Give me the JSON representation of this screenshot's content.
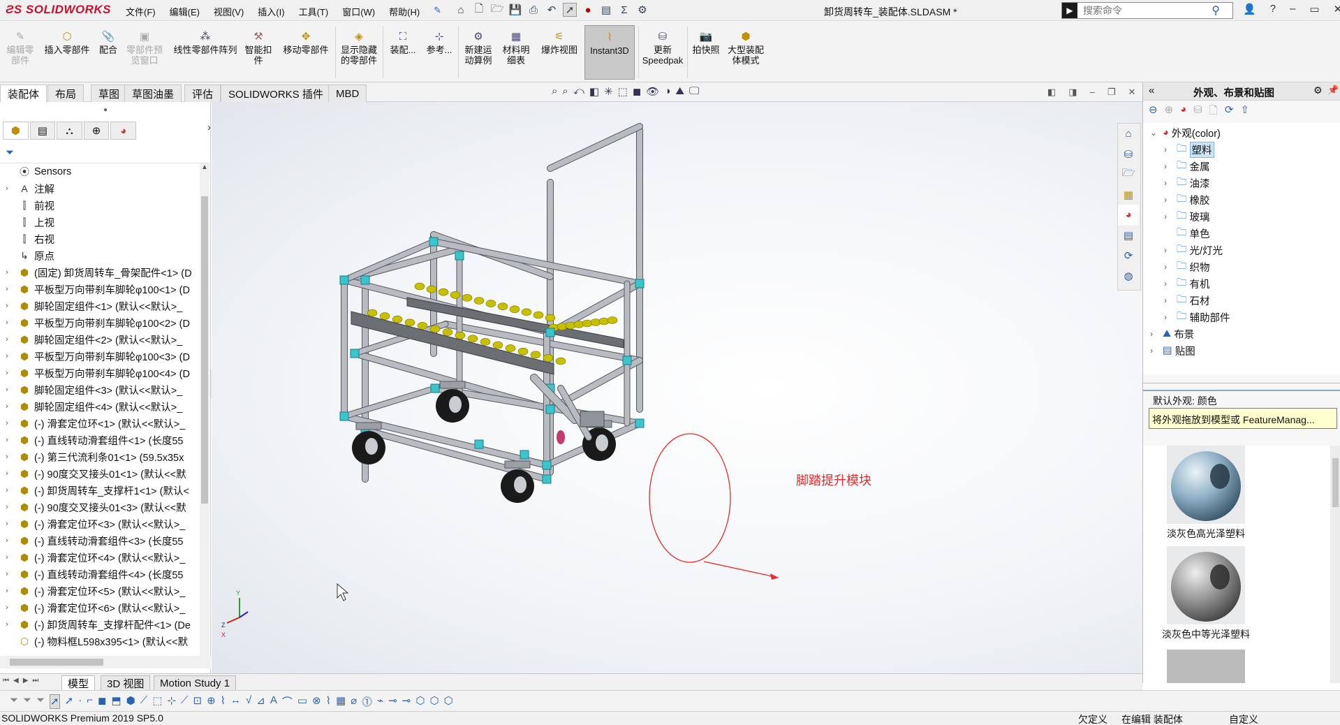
{
  "app": {
    "logo": "SOLIDWORKS",
    "doc_title": "卸货周转车_装配体.SLDASM *"
  },
  "menu": [
    "文件(F)",
    "编辑(E)",
    "视图(V)",
    "插入(I)",
    "工具(T)",
    "窗口(W)",
    "帮助(H)"
  ],
  "search": {
    "placeholder": "搜索命令"
  },
  "commands": {
    "edit_part": "编辑零\n部件",
    "insert_part": "插入零部件",
    "mate": "配合",
    "preview_window": "零部件预\n览窗口",
    "linear_pattern": "线性零部件阵列",
    "smart_fastener": "智能扣\n件",
    "move_component": "移动零部件",
    "show_hidden": "显示隐藏\n的零部件",
    "assembly": "装配...",
    "reference": "参考...",
    "new_motion": "新建运\n动算例",
    "bom": "材料明\n细表",
    "exploded_view": "爆炸视图",
    "instant3d": "Instant3D",
    "speedpak": "更新\nSpeedpak",
    "snapshot": "拍快照",
    "large_assembly": "大型装配\n体模式"
  },
  "tabs": [
    "装配体",
    "布局",
    "草图",
    "草图油墨",
    "评估",
    "SOLIDWORKS 插件",
    "MBD"
  ],
  "tree": [
    {
      "label": "Sensors",
      "icon": "sensor-icon",
      "expand": ""
    },
    {
      "label": "注解",
      "icon": "annotation-icon",
      "expand": "›"
    },
    {
      "label": "前视",
      "icon": "plane-icon",
      "expand": ""
    },
    {
      "label": "上视",
      "icon": "plane-icon",
      "expand": ""
    },
    {
      "label": "右视",
      "icon": "plane-icon",
      "expand": ""
    },
    {
      "label": "原点",
      "icon": "origin-icon",
      "expand": ""
    },
    {
      "label": "(固定) 卸货周转车_骨架配件<1> (D",
      "icon": "subassembly-icon",
      "expand": "›"
    },
    {
      "label": "平板型万向带刹车脚轮φ100<1> (D",
      "icon": "subassembly-icon",
      "expand": "›"
    },
    {
      "label": "脚轮固定组件<1> (默认<<默认>_",
      "icon": "subassembly-icon",
      "expand": "›"
    },
    {
      "label": "平板型万向带刹车脚轮φ100<2> (D",
      "icon": "subassembly-icon",
      "expand": "›"
    },
    {
      "label": "脚轮固定组件<2> (默认<<默认>_",
      "icon": "subassembly-icon",
      "expand": "›"
    },
    {
      "label": "平板型万向带刹车脚轮φ100<3> (D",
      "icon": "subassembly-icon",
      "expand": "›"
    },
    {
      "label": "平板型万向带刹车脚轮φ100<4> (D",
      "icon": "subassembly-icon",
      "expand": "›"
    },
    {
      "label": "脚轮固定组件<3> (默认<<默认>_",
      "icon": "subassembly-icon",
      "expand": "›"
    },
    {
      "label": "脚轮固定组件<4> (默认<<默认>_",
      "icon": "subassembly-icon",
      "expand": "›"
    },
    {
      "label": "(-) 滑套定位环<1> (默认<<默认>_",
      "icon": "subassembly-icon",
      "expand": "›"
    },
    {
      "label": "(-) 直线转动滑套组件<1> (长度55",
      "icon": "subassembly-icon",
      "expand": "›"
    },
    {
      "label": "(-) 第三代流利条01<1> (59.5x35x",
      "icon": "subassembly-icon",
      "expand": "›"
    },
    {
      "label": "(-) 90度交叉接头01<1> (默认<<默",
      "icon": "subassembly-icon",
      "expand": "›"
    },
    {
      "label": "(-) 卸货周转车_支撑杆1<1> (默认<",
      "icon": "subassembly-icon",
      "expand": "›"
    },
    {
      "label": "(-) 90度交叉接头01<3> (默认<<默",
      "icon": "subassembly-icon",
      "expand": "›"
    },
    {
      "label": "(-) 滑套定位环<3> (默认<<默认>_",
      "icon": "subassembly-icon",
      "expand": "›"
    },
    {
      "label": "(-) 直线转动滑套组件<3> (长度55",
      "icon": "subassembly-icon",
      "expand": "›"
    },
    {
      "label": "(-) 滑套定位环<4> (默认<<默认>_",
      "icon": "subassembly-icon",
      "expand": "›"
    },
    {
      "label": "(-) 直线转动滑套组件<4> (长度55",
      "icon": "subassembly-icon",
      "expand": "›"
    },
    {
      "label": "(-) 滑套定位环<5> (默认<<默认>_",
      "icon": "subassembly-icon",
      "expand": "›"
    },
    {
      "label": "(-) 滑套定位环<6> (默认<<默认>_",
      "icon": "subassembly-icon",
      "expand": "›"
    },
    {
      "label": "(-) 卸货周转车_支撑杆配件<1> (De",
      "icon": "subassembly-icon",
      "expand": "›"
    },
    {
      "label": "(-) 物料框L598x395<1> (默认<<默",
      "icon": "part-icon",
      "expand": ""
    }
  ],
  "annotation": {
    "text": "脚踏提升模块"
  },
  "taskpane": {
    "title": "外观、布景和贴图",
    "tree": [
      {
        "label": "外观(color)",
        "indent": 0,
        "expand": "⌄",
        "icon": "appearance-icon"
      },
      {
        "label": "塑料",
        "indent": 1,
        "expand": "›",
        "icon": "folder-icon",
        "sel": true
      },
      {
        "label": "金属",
        "indent": 1,
        "expand": "›",
        "icon": "folder-icon"
      },
      {
        "label": "油漆",
        "indent": 1,
        "expand": "›",
        "icon": "folder-icon"
      },
      {
        "label": "橡胶",
        "indent": 1,
        "expand": "›",
        "icon": "folder-icon"
      },
      {
        "label": "玻璃",
        "indent": 1,
        "expand": "›",
        "icon": "folder-icon"
      },
      {
        "label": "单色",
        "indent": 1,
        "expand": "",
        "icon": "folder-icon"
      },
      {
        "label": "光/灯光",
        "indent": 1,
        "expand": "›",
        "icon": "folder-icon"
      },
      {
        "label": "织物",
        "indent": 1,
        "expand": "›",
        "icon": "folder-icon"
      },
      {
        "label": "有机",
        "indent": 1,
        "expand": "›",
        "icon": "folder-icon"
      },
      {
        "label": "石材",
        "indent": 1,
        "expand": "›",
        "icon": "folder-icon"
      },
      {
        "label": "辅助部件",
        "indent": 1,
        "expand": "›",
        "icon": "folder-icon"
      },
      {
        "label": "布景",
        "indent": 0,
        "expand": "›",
        "icon": "scene-icon"
      },
      {
        "label": "贴图",
        "indent": 0,
        "expand": "›",
        "icon": "decal-icon"
      }
    ],
    "default_appearance": "默认外观: 颜色",
    "tooltip": "将外观拖放到模型或 FeatureManag...",
    "swatches": [
      "淡灰色高光泽塑料",
      "淡灰色中等光泽塑料"
    ]
  },
  "bottom_tabs": [
    "模型",
    "3D 视图",
    "Motion Study 1"
  ],
  "status": {
    "product": "SOLIDWORKS Premium 2019 SP5.0",
    "undefined": "欠定义",
    "editing": "在编辑 装配体",
    "custom": "自定义"
  },
  "colors": {
    "accent": "#c8102e",
    "frame": "#b8bcc2",
    "roller": "#c6c000",
    "wheel": "#1a1a1a",
    "connector": "#3ac4cc",
    "annot": "#e52b2b"
  }
}
